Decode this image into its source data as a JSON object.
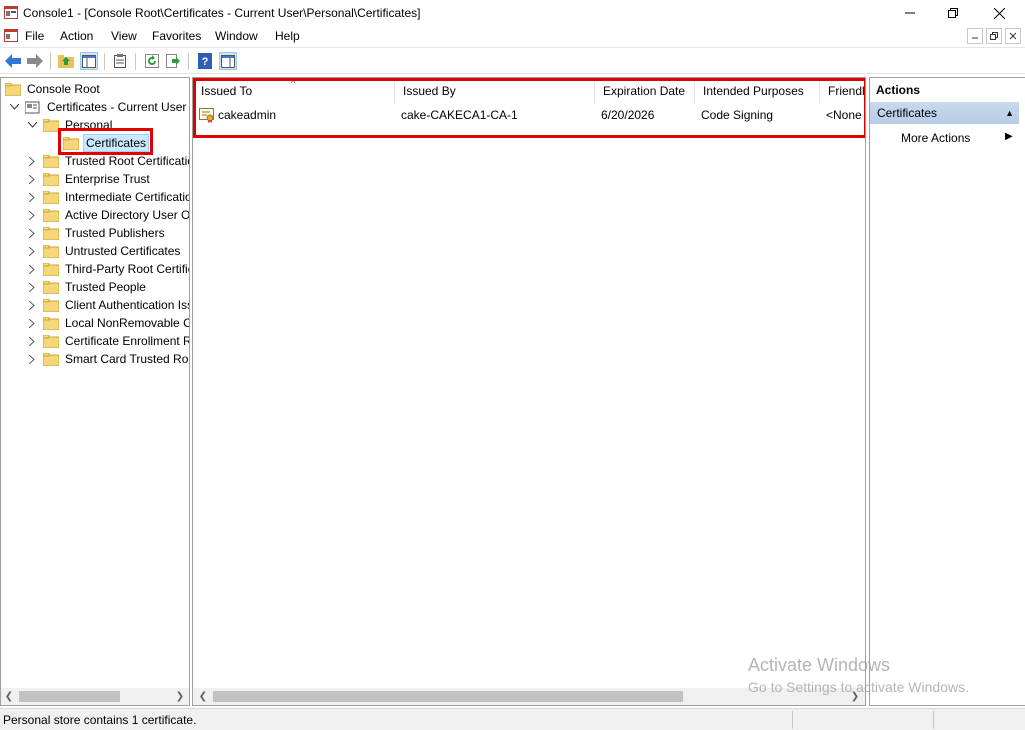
{
  "window": {
    "title": "Console1 - [Console Root\\Certificates - Current User\\Personal\\Certificates]",
    "minimize_icon": "minimize-icon",
    "restore_icon": "restore-icon",
    "close_icon": "close-icon"
  },
  "menubar": {
    "items": [
      "File",
      "Action",
      "View",
      "Favorites",
      "Window",
      "Help"
    ]
  },
  "toolbar": {
    "icons": [
      "back-arrow-icon",
      "forward-arrow-icon",
      "up-folder-icon",
      "show-hide-tree-icon",
      "properties-icon",
      "refresh-icon",
      "export-list-icon",
      "help-icon",
      "show-hide-action-pane-icon"
    ]
  },
  "tree": {
    "root": "Console Root",
    "snapin": "Certificates - Current User",
    "personal": "Personal",
    "selected": "Certificates",
    "stores": [
      "Trusted Root Certificatio",
      "Enterprise Trust",
      "Intermediate Certificatio",
      "Active Directory User Ob",
      "Trusted Publishers",
      "Untrusted Certificates",
      "Third-Party Root Certific",
      "Trusted People",
      "Client Authentication Iss",
      "Local NonRemovable Ce",
      "Certificate Enrollment Re",
      "Smart Card Trusted Roo"
    ]
  },
  "list": {
    "columns": [
      "Issued To",
      "Issued By",
      "Expiration Date",
      "Intended Purposes",
      "Friendly"
    ],
    "rows": [
      {
        "issued_to": "cakeadmin",
        "issued_by": "cake-CAKECA1-CA-1",
        "expiration": "6/20/2026",
        "purposes": "Code Signing",
        "friendly": "<None"
      }
    ]
  },
  "actions": {
    "title": "Actions",
    "section": "Certificates",
    "item": "More Actions"
  },
  "watermark": {
    "line1": "Activate Windows",
    "line2": "Go to Settings to activate Windows."
  },
  "status": {
    "text": "Personal store contains 1 certificate."
  },
  "colors": {
    "highlight_box": "#e00000",
    "selection": "#cce8ff",
    "folder": "#f5d77a"
  }
}
